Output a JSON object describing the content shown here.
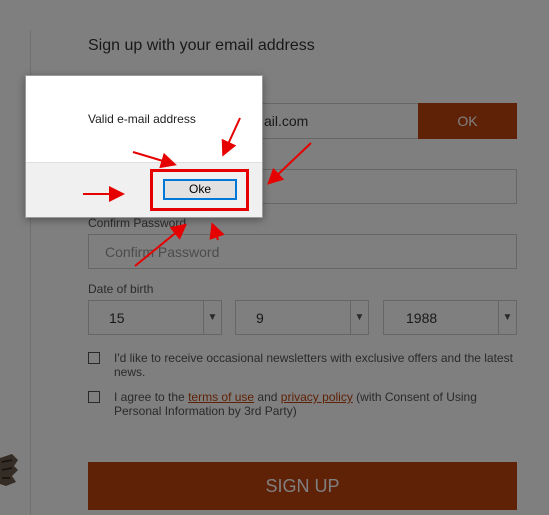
{
  "form": {
    "heading": "Sign up with your email address",
    "email_value": "ail.com",
    "ok_label": "OK",
    "confirm_password_label": "Confirm Password",
    "confirm_password_placeholder": "Confirm Password",
    "dob_label": "Date of birth",
    "dob_day": "15",
    "dob_month": "9",
    "dob_year": "1988",
    "newsletter_text": "I'd like to receive occasional newsletters with exclusive offers and the latest news.",
    "agree_prefix": "I agree to the ",
    "terms_link": "terms of use",
    "agree_and": " and ",
    "privacy_link": "privacy policy",
    "agree_suffix": " (with Consent of Using Personal Information by 3rd Party)",
    "signup_label": "SIGN UP",
    "accent_color": "#c1440e"
  },
  "dialog": {
    "message": "Valid e-mail address",
    "button_label": "Oke"
  },
  "annotations": {
    "highlight_color": "#e60000"
  }
}
